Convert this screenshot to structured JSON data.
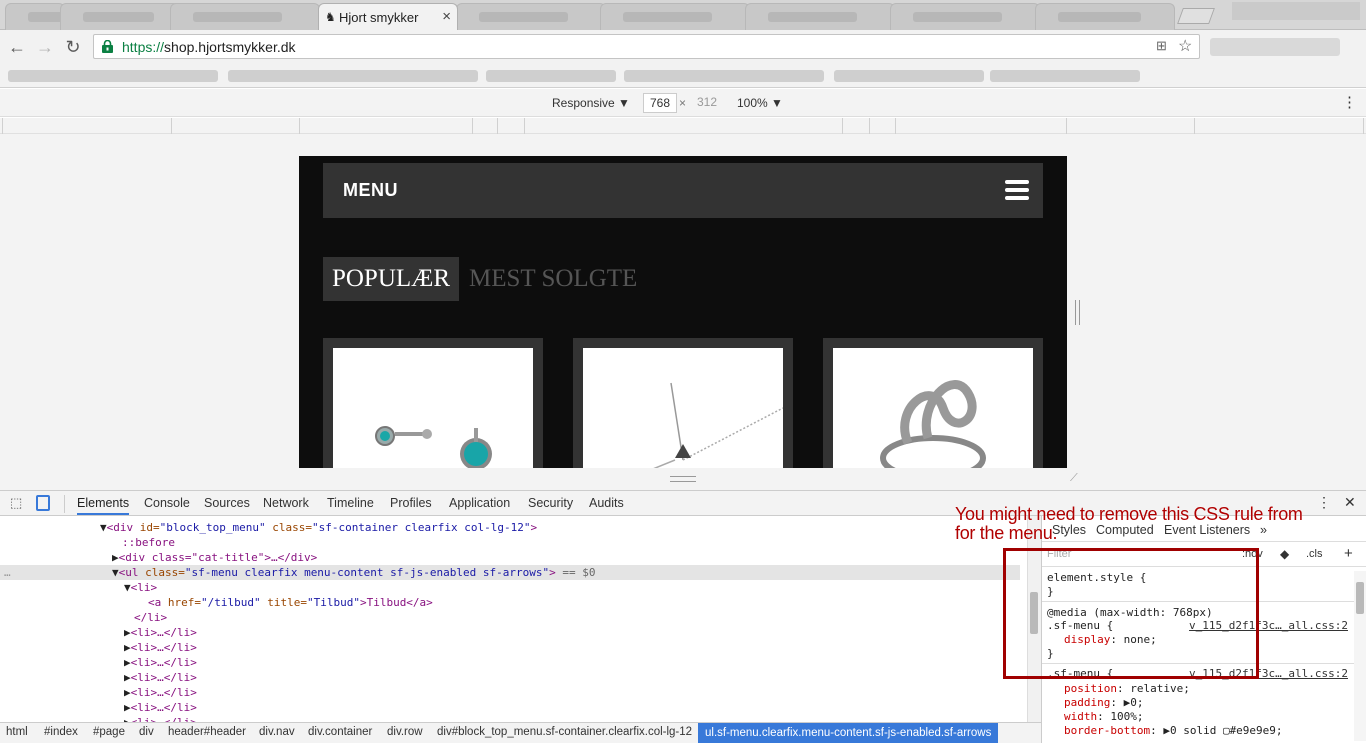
{
  "browser": {
    "active_tab_title": "Hjort smykker",
    "active_tab_close": "×",
    "url_protocol": "https://",
    "url_host": "shop.hjortsmykker.dk"
  },
  "device_toolbar": {
    "mode": "Responsive ▼",
    "width": "768",
    "times": "×",
    "height": "312",
    "zoom": "100% ▼",
    "more": "⋮"
  },
  "site": {
    "menu_label": "MENU",
    "tabs": [
      "POPULÆR",
      "MEST SOLGTE"
    ]
  },
  "devtools": {
    "tabs": [
      "Elements",
      "Console",
      "Sources",
      "Network",
      "Timeline",
      "Profiles",
      "Application",
      "Security",
      "Audits"
    ],
    "close": "✕",
    "more": "⋮",
    "styles_tabs": [
      "Styles",
      "Computed",
      "Event Listeners",
      "»"
    ],
    "filter_placeholder": "Filter",
    "hov": ":hov",
    "cls": ".cls",
    "plus": "+",
    "dom_lines": [
      {
        "indent": 100,
        "arrow": "▼",
        "html": "div_block"
      },
      {
        "indent": 122,
        "arrow": "",
        "text": "::before"
      },
      {
        "indent": 110,
        "arrow": "▶",
        "html": "div_cat"
      },
      {
        "indent": 110,
        "arrow": "▼",
        "html": "ul_sel"
      },
      {
        "indent": 122,
        "arrow": "▼",
        "html": "li_open"
      },
      {
        "indent": 146,
        "arrow": "",
        "html": "a_tilbud"
      },
      {
        "indent": 134,
        "arrow": "",
        "html": "li_close"
      },
      {
        "indent": 122,
        "arrow": "▶",
        "html": "li_collapsed"
      },
      {
        "indent": 122,
        "arrow": "▶",
        "html": "li_collapsed"
      },
      {
        "indent": 122,
        "arrow": "▶",
        "html": "li_collapsed"
      },
      {
        "indent": 122,
        "arrow": "▶",
        "html": "li_collapsed"
      },
      {
        "indent": 122,
        "arrow": "▶",
        "html": "li_collapsed"
      },
      {
        "indent": 122,
        "arrow": "▶",
        "html": "li_collapsed"
      }
    ],
    "dom_text": {
      "div_block_tag": "<div",
      "div_block_id_attr": " id=",
      "div_block_id_val": "\"block_top_menu\"",
      "div_block_class_attr": " class=",
      "div_block_class_val": "\"sf-container clearfix col-lg-12\"",
      "div_block_end": ">",
      "before": "::before",
      "div_cat": "<div class=\"cat-title\">…</div>",
      "ul_tag": "<ul",
      "ul_class_attr": " class=",
      "ul_class_val": "\"sf-menu clearfix menu-content sf-js-enabled sf-arrows\"",
      "ul_end": ">",
      "ul_eq": " == $0",
      "li_open": "<li>",
      "a_tag": "<a",
      "a_href_attr": " href=",
      "a_href_val": "\"/tilbud\"",
      "a_title_attr": " title=",
      "a_title_val": "\"Tilbud\"",
      "a_text": ">Tilbud</a>",
      "li_close": "</li>",
      "li_collapsed": "<li>…</li>"
    },
    "styles_rules": {
      "element_style": "element.style {",
      "close_brace": "}",
      "media": "@media (max-width: 768px)",
      "sfmenu_sel": ".sf-menu {",
      "sfmenu_link": "v_115_d2f1f3c…_all.css:2",
      "display_prop": "display",
      "display_val": ": none;",
      "position_prop": "position",
      "position_val": ": relative;",
      "padding_prop": "padding",
      "padding_val": ": ▶0;",
      "width_prop": "width",
      "width_val": ": 100%;",
      "border_prop": "border-bottom",
      "border_val": ": ▶0 solid ▢#e9e9e9;"
    },
    "breadcrumbs": [
      "html",
      "#index",
      "#page",
      "div",
      "header#header",
      "div.nav",
      "div.container",
      "div.row",
      "div#block_top_menu.sf-container.clearfix.col-lg-12",
      "ul.sf-menu.clearfix.menu-content.sf-js-enabled.sf-arrows"
    ]
  },
  "annotation": {
    "text": "You might need to remove this CSS rule from for the menu.",
    "color": "#b00000"
  }
}
